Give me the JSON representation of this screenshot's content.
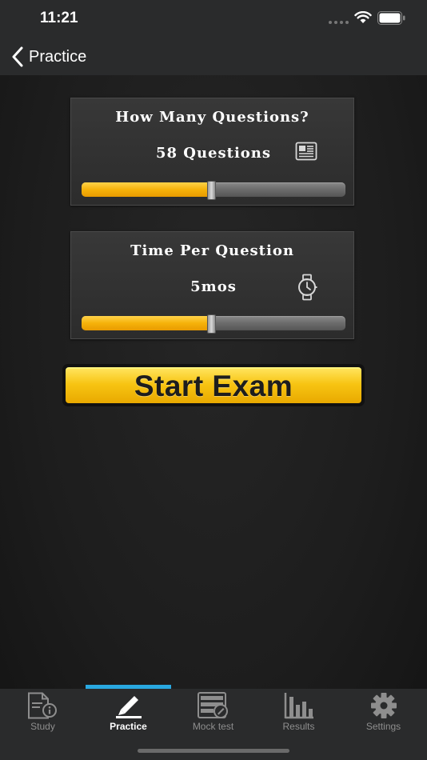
{
  "status_bar": {
    "time": "11:21"
  },
  "nav": {
    "back_label": "Practice"
  },
  "questions_panel": {
    "title": "How Many Questions?",
    "value_text": "58 Questions",
    "icon": "newspaper-icon",
    "slider_fraction": 0.49
  },
  "time_panel": {
    "title": "Time Per Question",
    "value_text": "5mos",
    "icon": "stopwatch-icon",
    "slider_fraction": 0.49
  },
  "start_button": {
    "label": "Start Exam"
  },
  "colors": {
    "accent_yellow": "#f6b20a",
    "tab_indicator": "#29a8e0",
    "bar_bg": "#2a2b2c"
  },
  "tabs": [
    {
      "label": "Study",
      "icon": "study-document-icon",
      "active": false
    },
    {
      "label": "Practice",
      "icon": "pencil-icon",
      "active": true
    },
    {
      "label": "Mock test",
      "icon": "mock-test-icon",
      "active": false
    },
    {
      "label": "Results",
      "icon": "bar-chart-icon",
      "active": false
    },
    {
      "label": "Settings",
      "icon": "gear-icon",
      "active": false
    }
  ]
}
